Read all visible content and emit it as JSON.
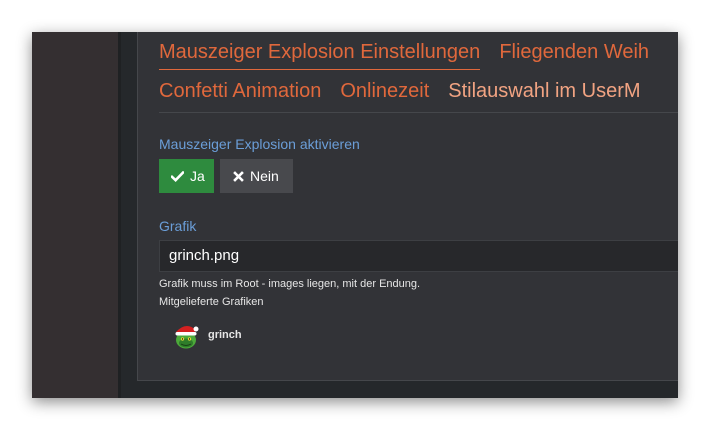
{
  "tabs": {
    "row1": [
      {
        "label": "Mauszeiger Explosion Einstellungen",
        "active": true
      },
      {
        "label": "Fliegenden Weih"
      }
    ],
    "row2": [
      {
        "label": "Confetti Animation"
      },
      {
        "label": "Onlinezeit"
      },
      {
        "label": "Stilauswahl im UserM"
      }
    ]
  },
  "activate": {
    "label": "Mauszeiger Explosion aktivieren",
    "yes_label": "Ja",
    "no_label": "Nein",
    "selected": "Ja"
  },
  "grafik": {
    "label": "Grafik",
    "value": "grinch.png",
    "help_text": "Grafik muss im Root - images liegen, mit der Endung.",
    "provided_label": "Mitgelieferte Grafiken",
    "items": [
      {
        "name": "grinch",
        "icon": "grinch-icon"
      }
    ]
  },
  "colors": {
    "accent": "#e0683c",
    "link_blue": "#6b9ed8",
    "success": "#2e8b3e",
    "panel_bg": "#323337"
  }
}
